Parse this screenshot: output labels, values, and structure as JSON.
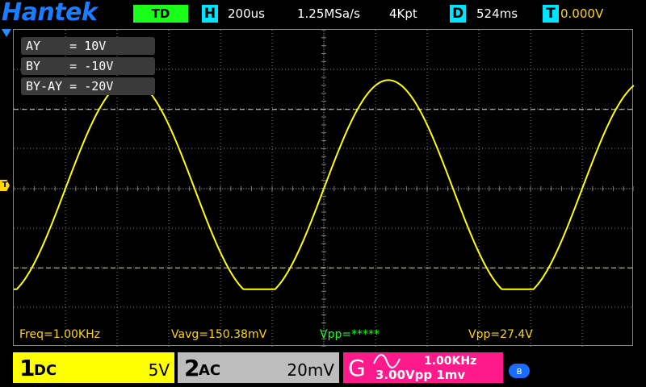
{
  "header": {
    "brand": "Hantek",
    "mode": "TD",
    "timebase_icon": "H",
    "timebase": "200us",
    "sample_rate": "1.25MSa/s",
    "memory_depth": "4Kpt",
    "delay_icon": "D",
    "delay": "524ms",
    "trigger_icon": "T",
    "trigger_level": "0.000V"
  },
  "cursors": [
    "AY    = 10V",
    "BY    = -10V",
    "BY-AY = -20V"
  ],
  "markers": {
    "trigger": "T"
  },
  "measurements": {
    "freq": "Freq=1.00KHz",
    "vavg": "Vavg=150.38mV",
    "vpp_ch2": "Vpp=*****",
    "vpp_ch1": "Vpp=27.4V"
  },
  "channels": {
    "ch1": {
      "number": "1",
      "coupling": "DC",
      "scale": "5V"
    },
    "ch2": {
      "number": "2",
      "coupling": "AC",
      "scale": "20mV"
    }
  },
  "generator": {
    "label": "G",
    "frequency": "1.00KHz",
    "amplitude": "3.00Vpp  1mv"
  },
  "status": {
    "bluetooth_icon": "bluetooth-icon",
    "bluetooth_glyph": "ʙ"
  },
  "colors": {
    "ch1": "#ffff00",
    "ch2": "#bdbdbd",
    "generator": "#ff1a8c",
    "brand": "#1a7cff",
    "mode_badge": "#1aff1a",
    "info_icon": "#00e5ff",
    "grid": "#808080",
    "cursor_line": "#d8d8a0"
  },
  "waveform": {
    "channel": "ch1",
    "shape": "clipped sine",
    "frequency_hz": 1000,
    "vpp": 27.4,
    "volts_per_div": 5,
    "time_per_div_us": 200,
    "clip_low_v": -12.7
  }
}
